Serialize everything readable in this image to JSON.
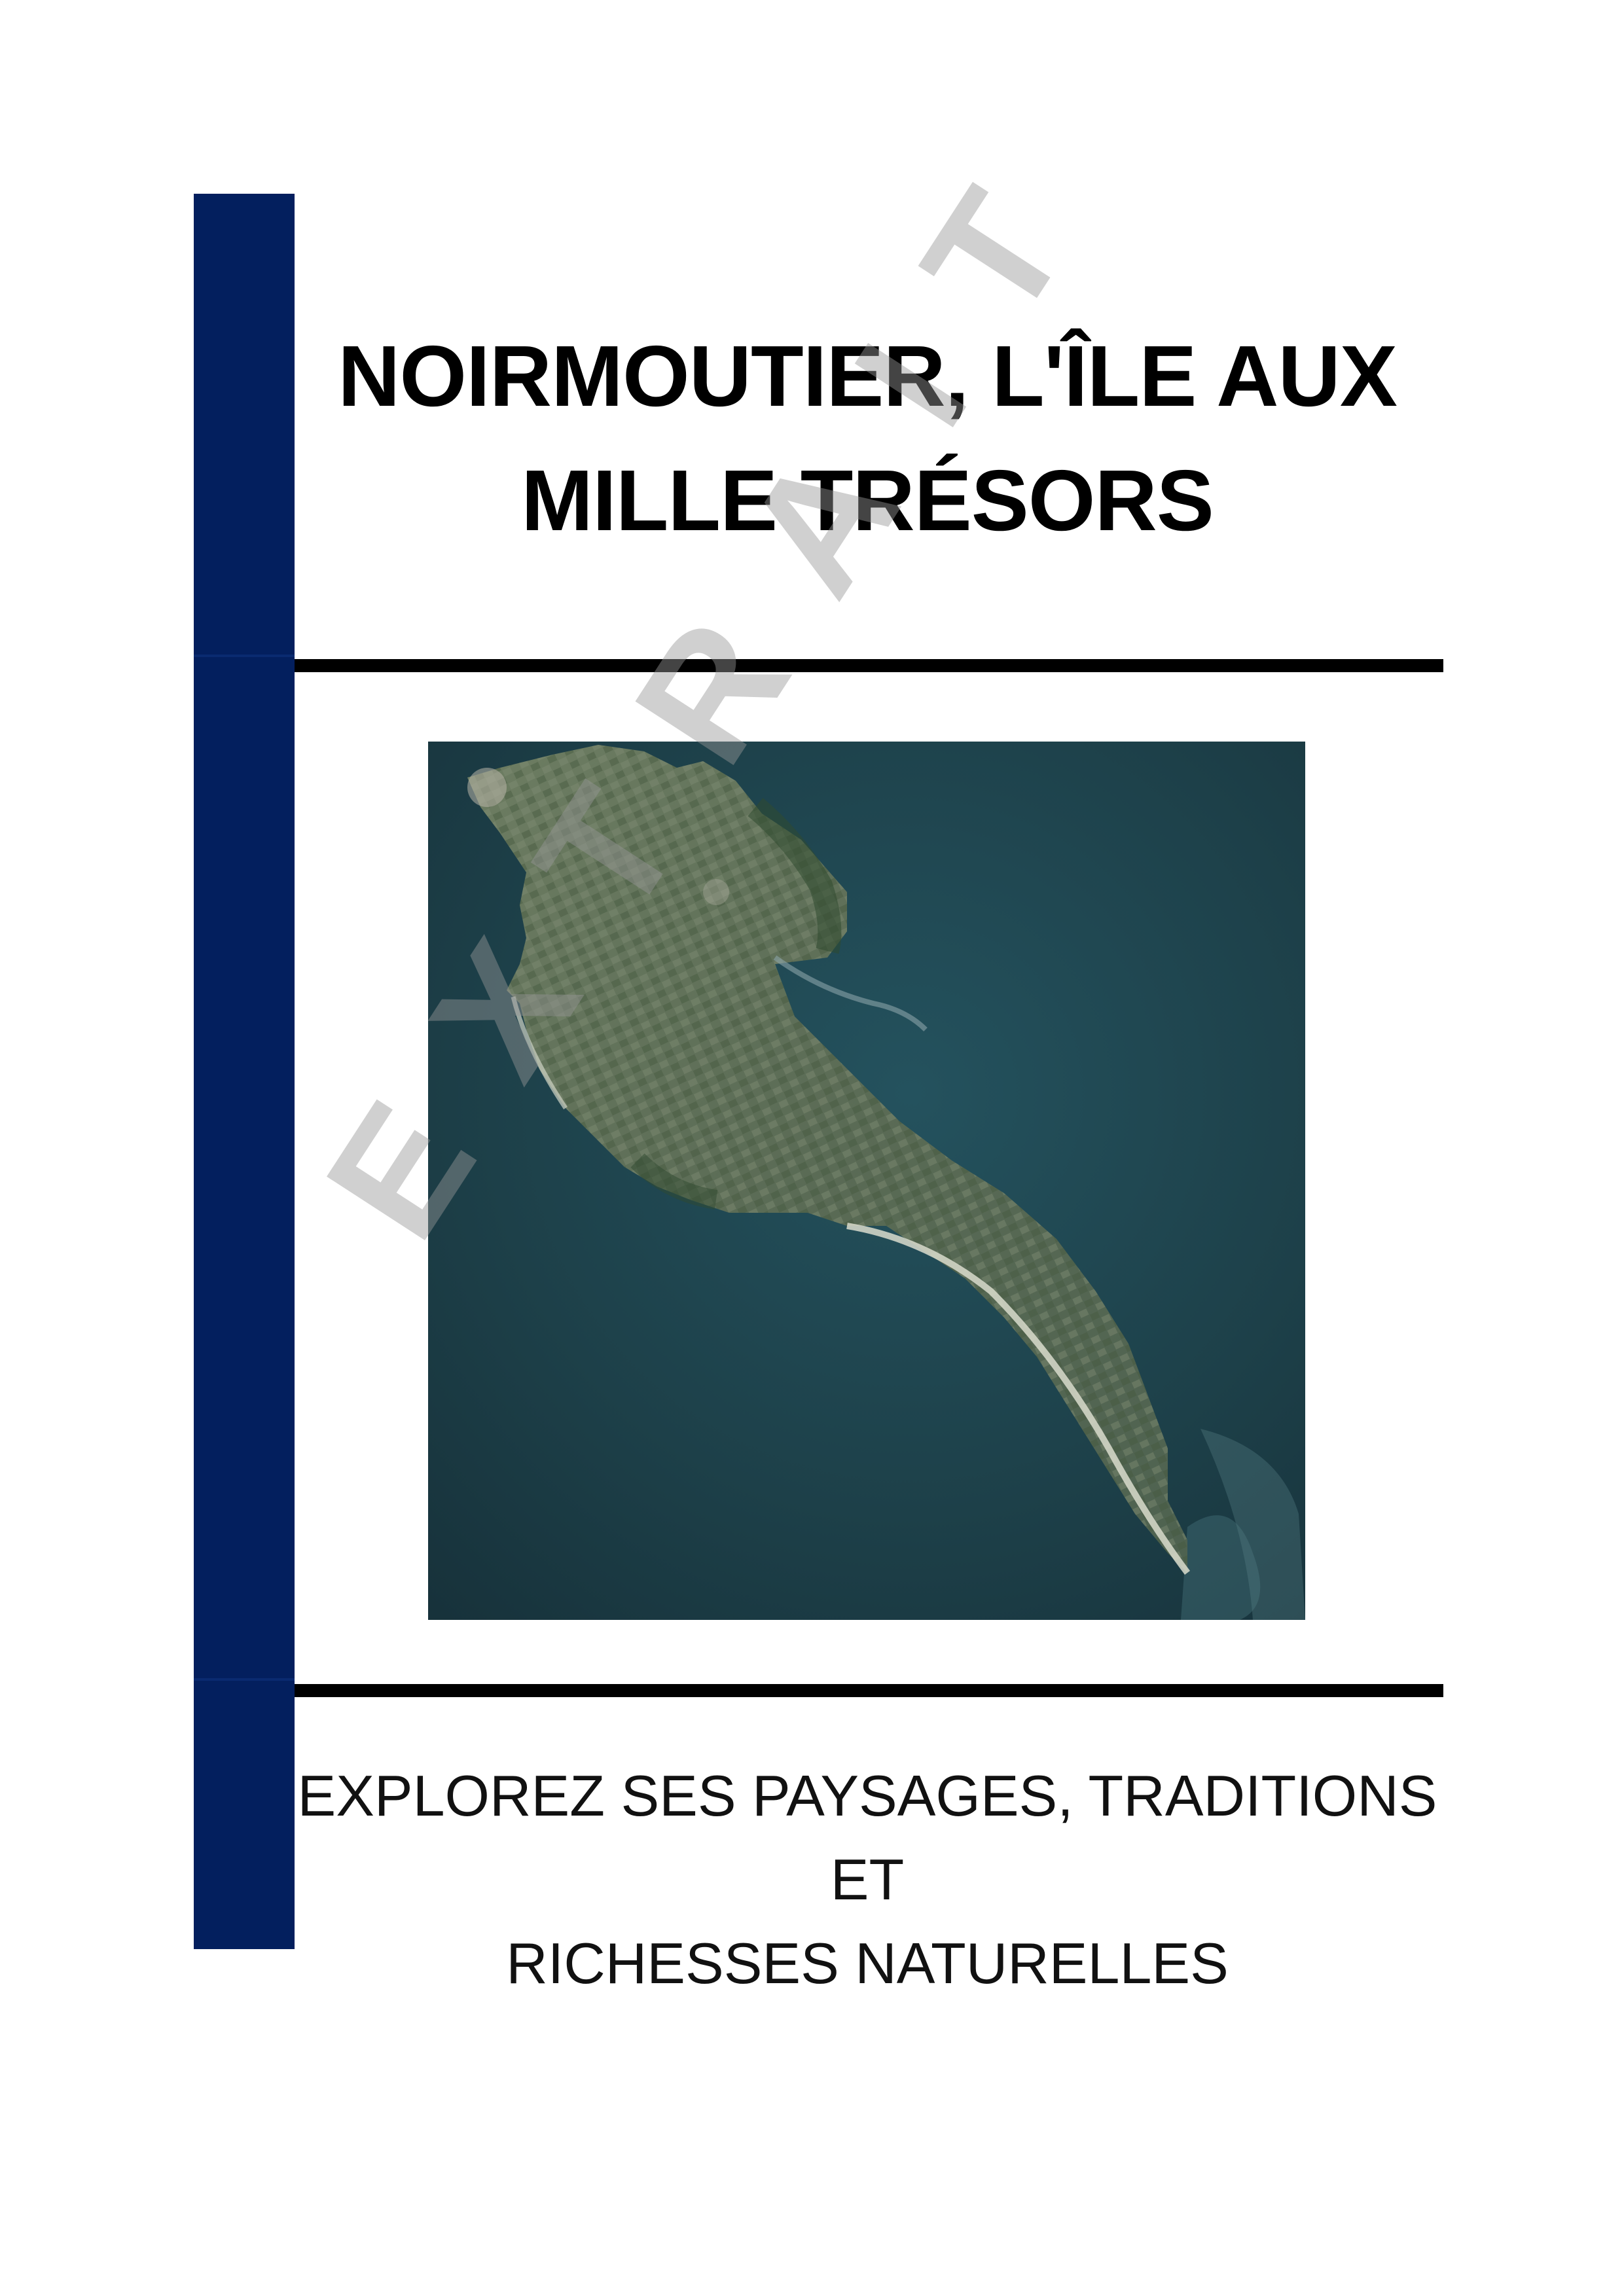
{
  "title": {
    "line1": "NOIRMOUTIER, L'ÎLE AUX",
    "line2": "MILLE TRÉSORS"
  },
  "subtitle": {
    "line1": "EXPLOREZ SES PAYSAGES, TRADITIONS ET",
    "line2": "RICHESSES NATURELLES"
  },
  "watermark": "EXTRAIT",
  "colors": {
    "side_bar": "#031f5e",
    "rules": "#000000",
    "sea": "#1e3f4a",
    "land": "#5d6f56"
  },
  "image": {
    "subject": "satellite-view-of-island"
  }
}
